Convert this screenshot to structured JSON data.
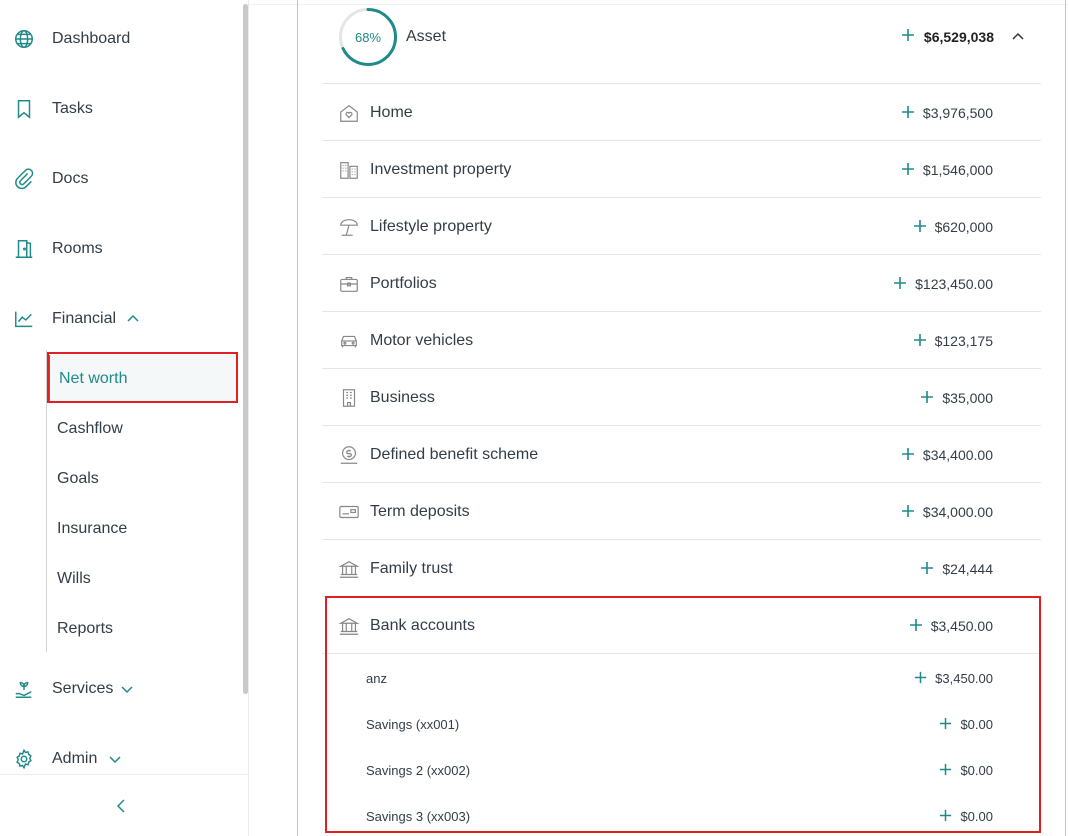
{
  "sidebar": {
    "items": [
      {
        "id": "dashboard",
        "label": "Dashboard",
        "icon": "globe-icon"
      },
      {
        "id": "tasks",
        "label": "Tasks",
        "icon": "bookmark-icon"
      },
      {
        "id": "docs",
        "label": "Docs",
        "icon": "paperclip-icon"
      },
      {
        "id": "rooms",
        "label": "Rooms",
        "icon": "door-icon"
      },
      {
        "id": "financial",
        "label": "Financial",
        "icon": "chart-line-icon",
        "expanded": true
      },
      {
        "id": "services",
        "label": "Services",
        "icon": "hand-plant-icon",
        "expanded": false
      },
      {
        "id": "admin",
        "label": "Admin",
        "icon": "gear-icon",
        "expanded": false
      }
    ],
    "financial_sub": [
      {
        "label": "Net worth",
        "active": true
      },
      {
        "label": "Cashflow"
      },
      {
        "label": "Goals"
      },
      {
        "label": "Insurance"
      },
      {
        "label": "Wills"
      },
      {
        "label": "Reports"
      }
    ]
  },
  "asset": {
    "percent_label": "68%",
    "percent": 68,
    "title": "Asset",
    "total": "$6,529,038"
  },
  "rows": [
    {
      "label": "Home",
      "amount": "$3,976,500",
      "icon": "home-heart-icon"
    },
    {
      "label": "Investment property",
      "amount": "$1,546,000",
      "icon": "buildings-icon"
    },
    {
      "label": "Lifestyle property",
      "amount": "$620,000",
      "icon": "beach-umbrella-icon"
    },
    {
      "label": "Portfolios",
      "amount": "$123,450.00",
      "icon": "briefcase-icon"
    },
    {
      "label": "Motor vehicles",
      "amount": "$123,175",
      "icon": "car-icon"
    },
    {
      "label": "Business",
      "amount": "$35,000",
      "icon": "office-building-icon"
    },
    {
      "label": "Defined benefit scheme",
      "amount": "$34,400.00",
      "icon": "dollar-coin-icon"
    },
    {
      "label": "Term deposits",
      "amount": "$34,000.00",
      "icon": "card-icon"
    },
    {
      "label": "Family trust",
      "amount": "$24,444",
      "icon": "bank-icon"
    },
    {
      "label": "Bank accounts",
      "amount": "$3,450.00",
      "icon": "bank-icon"
    }
  ],
  "bank_sub": [
    {
      "label": "anz",
      "amount": "$3,450.00"
    },
    {
      "label": "Savings (xx001)",
      "amount": "$0.00"
    },
    {
      "label": "Savings 2 (xx002)",
      "amount": "$0.00"
    },
    {
      "label": "Savings 3 (xx003)",
      "amount": "$0.00"
    }
  ],
  "colors": {
    "accent": "#1f8a88",
    "highlight": "#e02020",
    "text": "#333d47"
  }
}
